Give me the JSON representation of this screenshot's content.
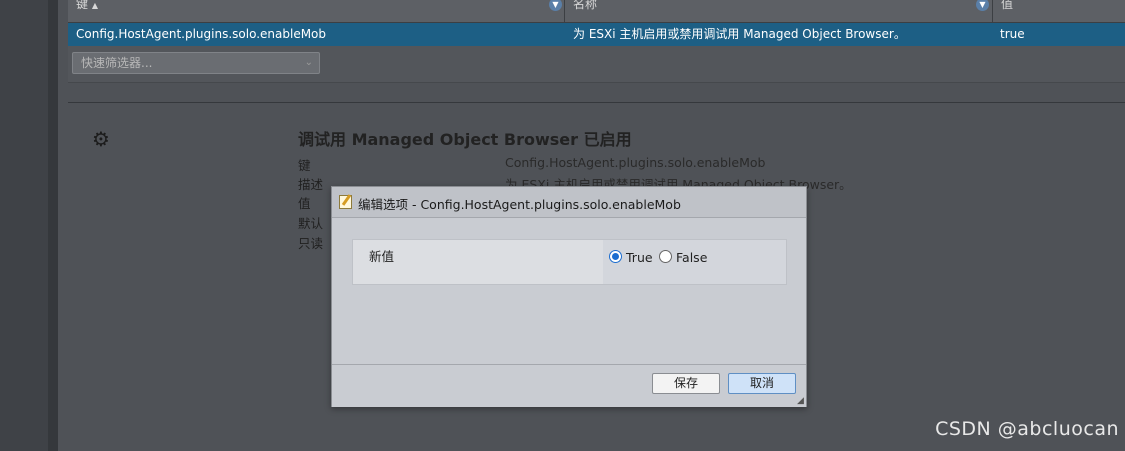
{
  "grid": {
    "headers": {
      "key": "键",
      "key_sort": "▲",
      "name": "名称",
      "value": "值"
    },
    "selected_row": {
      "key": "Config.HostAgent.plugins.solo.enableMob",
      "name": "为 ESXi 主机启用或禁用调试用 Managed Object Browser。",
      "value": "true"
    },
    "filter_placeholder": "快速筛选器..."
  },
  "detail": {
    "title": "调试用 Managed Object Browser 已启用",
    "labels": [
      "键",
      "描述",
      "值",
      "默认",
      "只读"
    ],
    "key_value": "Config.HostAgent.plugins.solo.enableMob",
    "description_value": "为 ESXi 主机启用或禁用调试用 Managed Object Browser。"
  },
  "dialog": {
    "title": "编辑选项 - Config.HostAgent.plugins.solo.enableMob",
    "field_label": "新值",
    "options": [
      {
        "label": "True",
        "checked": true
      },
      {
        "label": "False",
        "checked": false
      }
    ],
    "save_label": "保存",
    "cancel_label": "取消"
  },
  "watermark": "CSDN @abcluocan",
  "icons": {
    "sort_filter": "chevron-down-icon",
    "gear": "gear-icon",
    "dialog": "edit-note-icon",
    "resize": "resize-grip-icon"
  }
}
